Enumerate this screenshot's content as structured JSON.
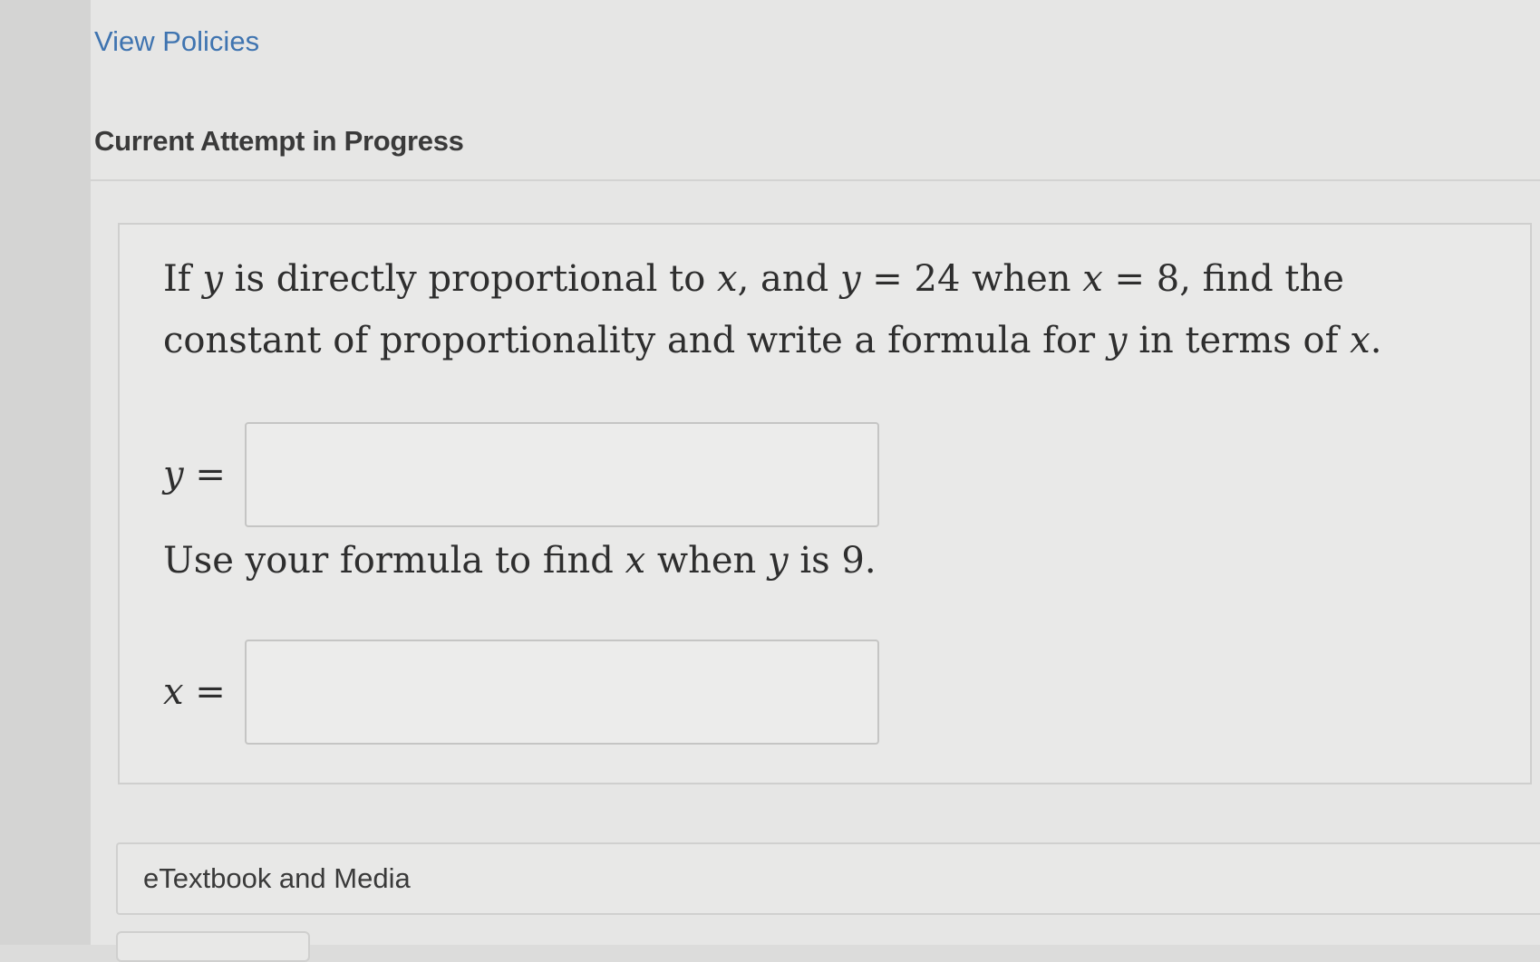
{
  "header": {
    "view_policies": "View Policies",
    "attempt_title": "Current Attempt in Progress"
  },
  "question": {
    "parts": [
      {
        "t": "If ",
        "v": false
      },
      {
        "t": "y",
        "v": true
      },
      {
        "t": " is directly proportional to ",
        "v": false
      },
      {
        "t": "x",
        "v": true
      },
      {
        "t": ", and ",
        "v": false
      },
      {
        "t": "y",
        "v": true
      },
      {
        "t": " = 24 when ",
        "v": false
      },
      {
        "t": "x",
        "v": true
      },
      {
        "t": " = 8, find the constant of proportionality and write a formula for ",
        "v": false
      },
      {
        "t": "y",
        "v": true
      },
      {
        "t": " in terms of ",
        "v": false
      },
      {
        "t": "x",
        "v": true
      },
      {
        "t": ".",
        "v": false
      }
    ],
    "answer_y": {
      "label": "y =",
      "value": ""
    },
    "sub_parts": [
      {
        "t": "Use your formula to find ",
        "v": false
      },
      {
        "t": "x",
        "v": true
      },
      {
        "t": " when ",
        "v": false
      },
      {
        "t": "y",
        "v": true
      },
      {
        "t": " is 9.",
        "v": false
      }
    ],
    "answer_x": {
      "label": "x =",
      "value": ""
    }
  },
  "footer": {
    "etextbook_label": "eTextbook and Media"
  }
}
